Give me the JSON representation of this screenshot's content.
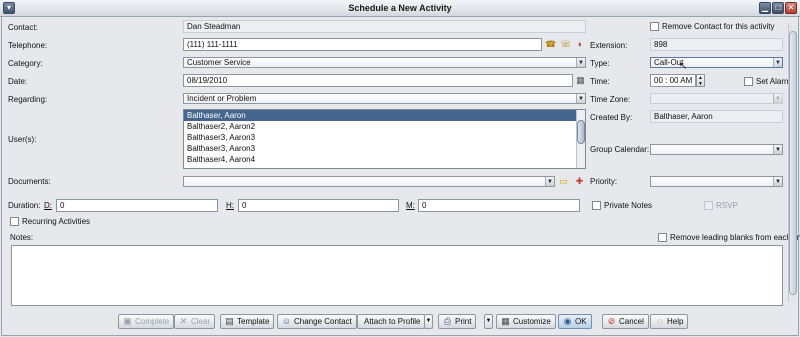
{
  "window": {
    "title": "Schedule a New Activity"
  },
  "labels": {
    "contact": "Contact:",
    "telephone": "Telephone:",
    "category": "Category:",
    "date": "Date:",
    "regarding": "Regarding:",
    "users": "User(s):",
    "documents": "Documents:",
    "duration": "Duration:",
    "d": "D:",
    "h": "H:",
    "m": "M:",
    "extension": "Extension:",
    "type": "Type:",
    "time": "Time:",
    "time_zone": "Time Zone:",
    "created_by": "Created By:",
    "group_calendar": "Group Calendar:",
    "priority": "Priority:",
    "notes": "Notes:"
  },
  "values": {
    "contact": "Dan Steadman",
    "telephone": "(111) 111-1111",
    "category": "Customer Service",
    "date": "08/19/2010",
    "regarding": "Incident or Problem",
    "documents": "",
    "duration_d": "0",
    "duration_h": "0",
    "duration_m": "0",
    "extension": "898",
    "type": "Call-Out",
    "time_hh": "00",
    "time_sep": ":",
    "time_mm": "00",
    "time_ampm": "AM",
    "time_zone": "",
    "created_by": "Balthaser, Aaron",
    "group_calendar": "",
    "priority": "",
    "notes": ""
  },
  "users": [
    "Balthaser, Aaron",
    "Balthaser2, Aaron2",
    "Balthaser3, Aaron3",
    "Balthaser3, Aaron3",
    "Balthaser4, Aaron4"
  ],
  "selected_user_index": 0,
  "checkboxes": {
    "remove_contact": "Remove Contact for this activity",
    "set_alarm": "Set Alarm",
    "private_notes": "Private Notes",
    "rsvp": "RSVP",
    "recurring": "Recurring Activities",
    "remove_blanks": "Remove leading blanks from each line"
  },
  "buttons": {
    "complete": "Complete",
    "clear": "Clear",
    "template": "Template",
    "change_contact": "Change Contact",
    "attach_to_profile": "Attach to Profile",
    "print": "Print",
    "customize": "Customize",
    "ok": "OK",
    "cancel": "Cancel",
    "help": "Help"
  },
  "icons": {
    "dial_phone": "phone-icon",
    "dial_alt": "phone-dial-icon",
    "speaker": "speaker-icon",
    "calendar": "calendar-icon",
    "open_folder": "folder-icon",
    "attach_doc": "attach-document-icon"
  },
  "colors": {
    "selection": "#44668e",
    "title_bar": "#d4d8de",
    "ok_button": "#b9cfe8"
  }
}
